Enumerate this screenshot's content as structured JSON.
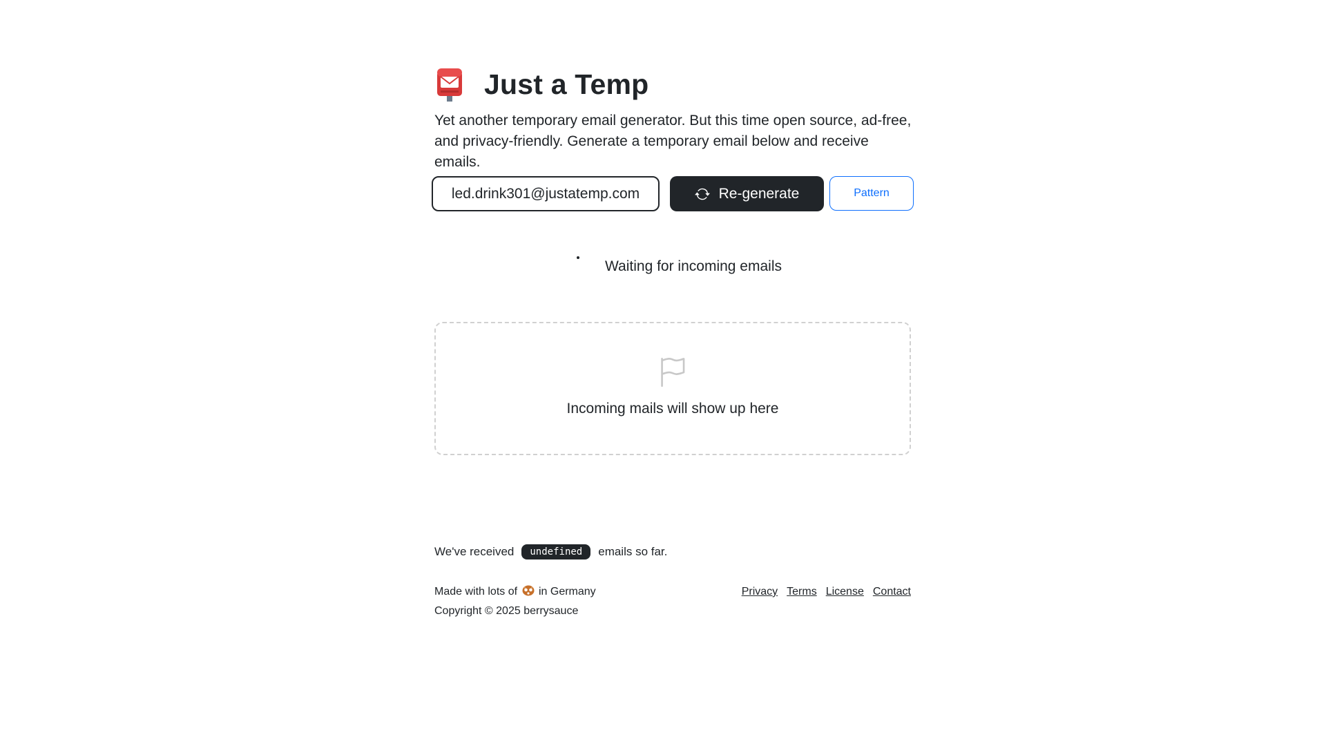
{
  "header": {
    "logo_icon": "postbox-icon",
    "title": "Just a Temp",
    "subtitle": "Yet another temporary email generator. But this time open source, ad-free, and privacy-friendly. Generate a temporary email below and receive emails."
  },
  "controls": {
    "email_address": "led.drink301@justatemp.com",
    "regenerate_icon": "refresh-icon",
    "regenerate_label": "Re-generate",
    "pattern_label": "Pattern"
  },
  "status": {
    "waiting_text": "Waiting for incoming emails"
  },
  "mailbox": {
    "empty_icon": "flag-icon",
    "empty_text": "Incoming mails will show up here"
  },
  "stats": {
    "prefix": "We've received",
    "count": "undefined",
    "suffix": "emails so far."
  },
  "footer": {
    "made_with_prefix": "Made with lots of",
    "made_with_icon": "pretzel-icon",
    "made_with_suffix": "in Germany",
    "copyright": "Copyright © 2025 berrysauce",
    "links": [
      "Privacy",
      "Terms",
      "License",
      "Contact"
    ]
  },
  "colors": {
    "primary_dark": "#212529",
    "accent_blue": "#0d6efd",
    "dashed_border": "#d0d0d0",
    "background": "#ffffff"
  }
}
